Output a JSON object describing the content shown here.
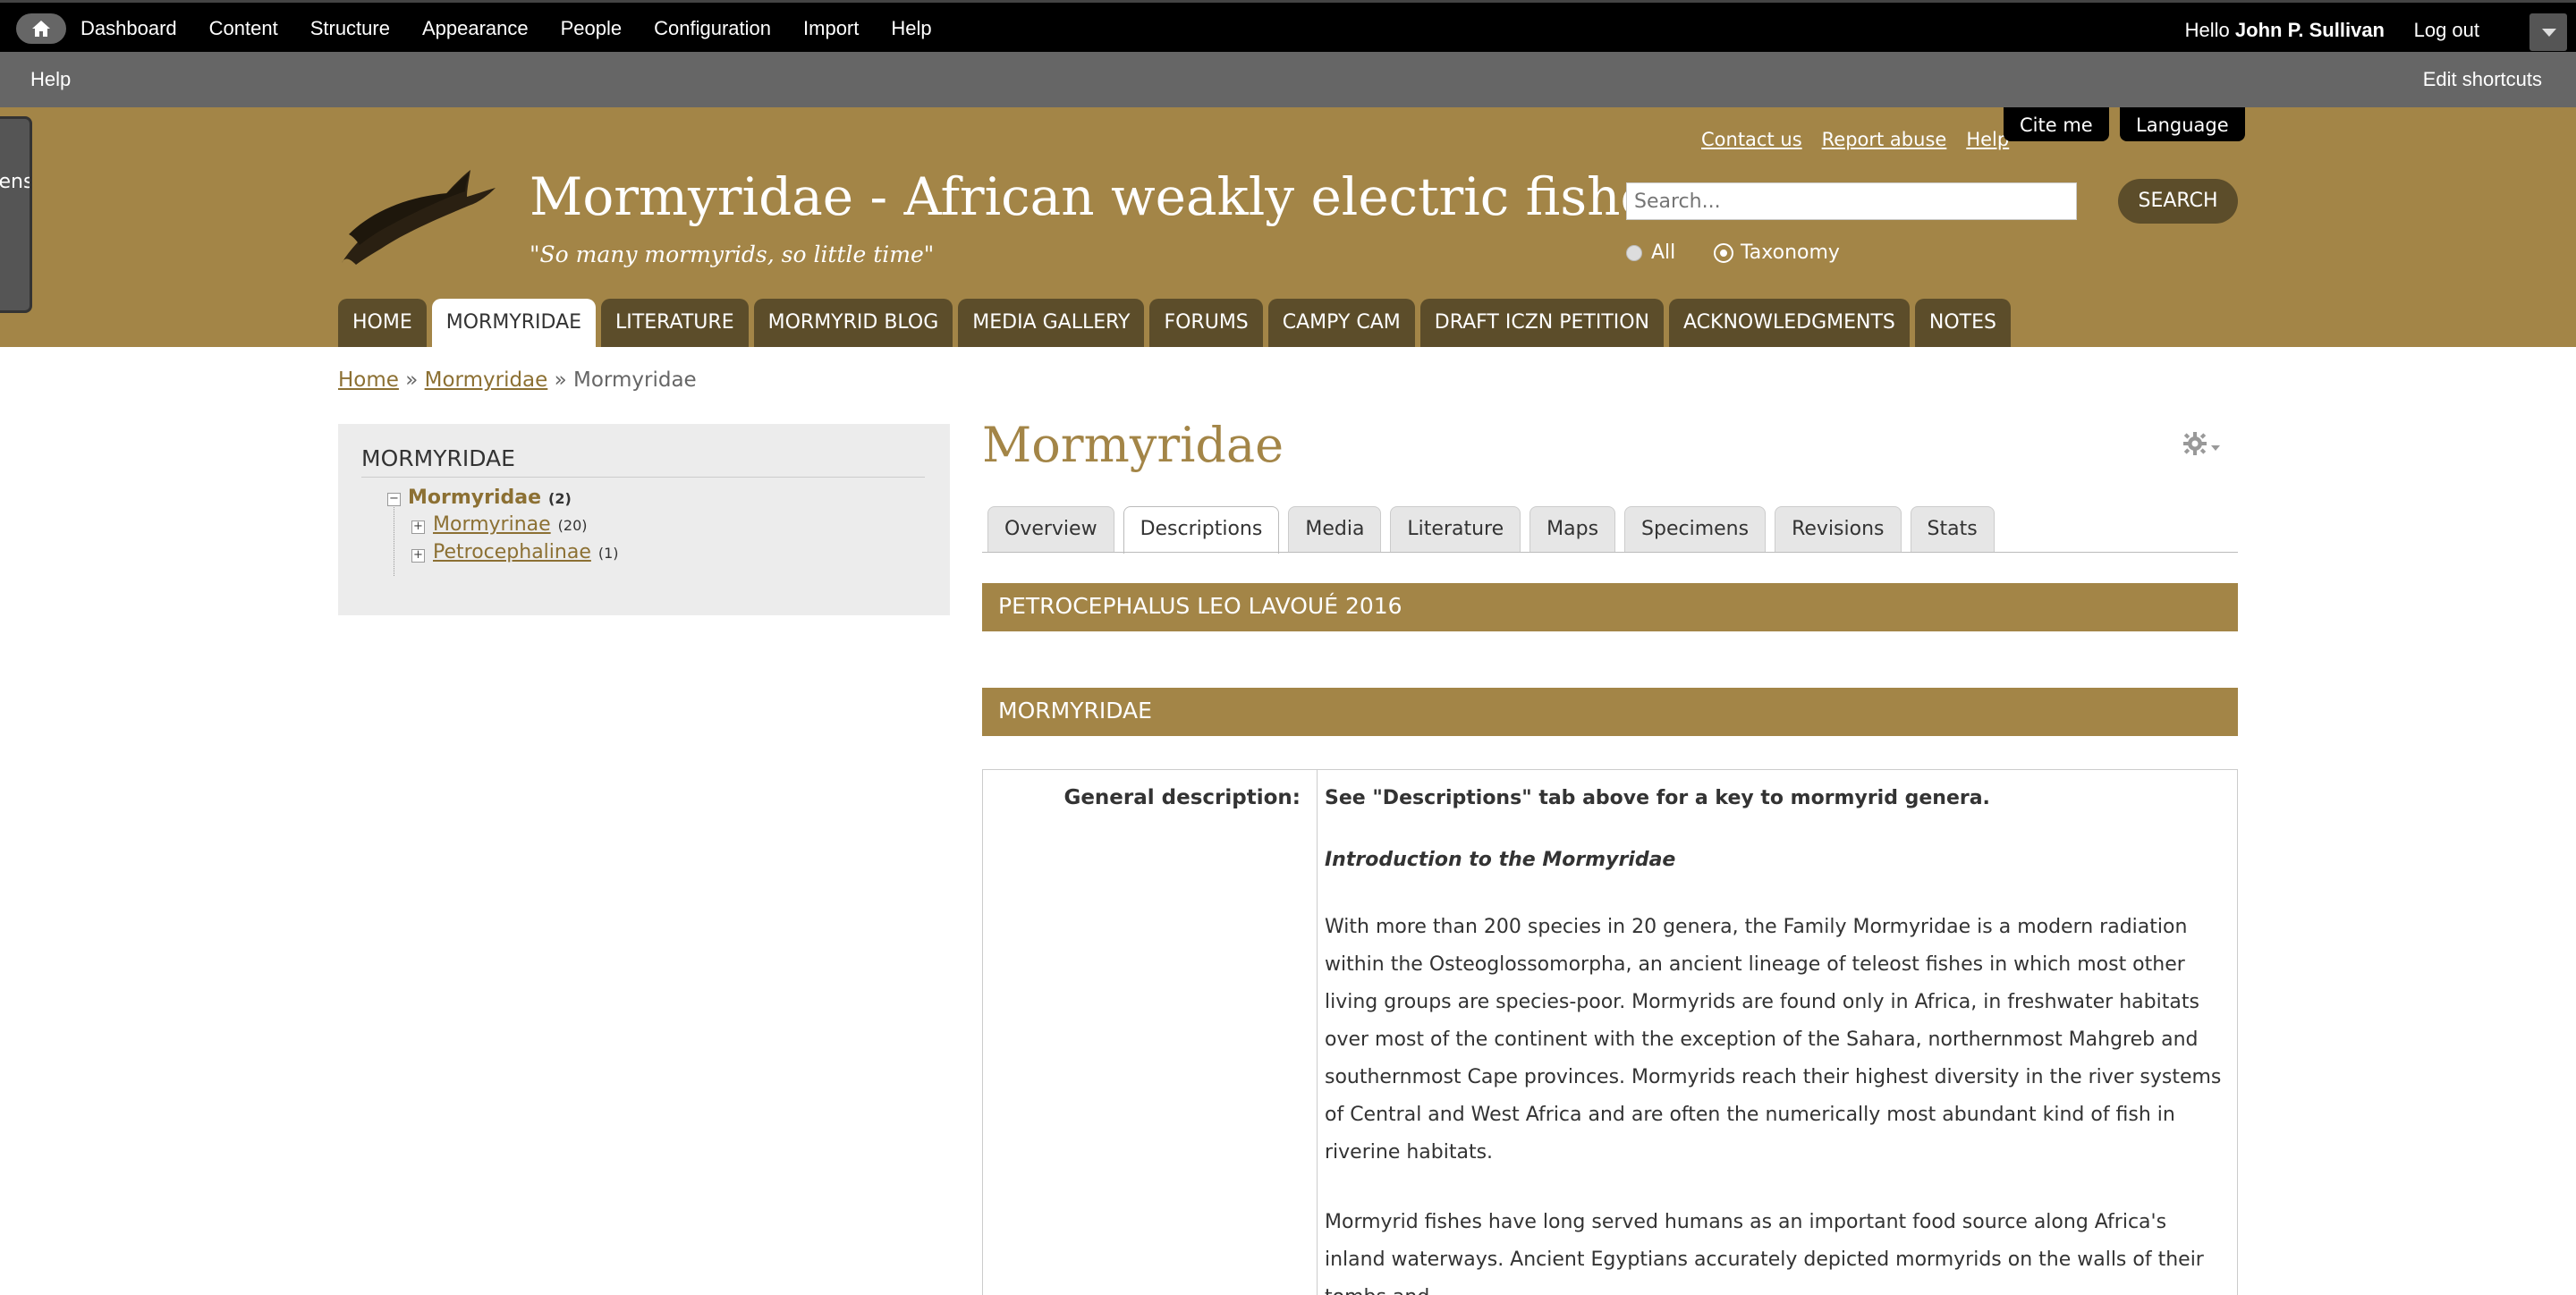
{
  "admin_bar": {
    "menu": [
      "Dashboard",
      "Content",
      "Structure",
      "Appearance",
      "People",
      "Configuration",
      "Import",
      "Help"
    ],
    "hello_prefix": "Hello",
    "user_name": "John P. Sullivan",
    "logout": "Log out"
  },
  "shortcut_bar": {
    "help": "Help",
    "edit_shortcuts": "Edit shortcuts"
  },
  "side_tab": {
    "label": "sens"
  },
  "header": {
    "site_name": "Mormyridae - African weakly electric fishes",
    "slogan": "\"So many mormyrids, so little time\"",
    "top_links": [
      "Contact us",
      "Report abuse",
      "Help"
    ],
    "cite_me": "Cite me",
    "language": "Language",
    "search_placeholder": "Search...",
    "search_button": "SEARCH",
    "radio_all": "All",
    "radio_taxonomy": "Taxonomy",
    "radio_selected": "Taxonomy"
  },
  "main_nav": [
    "HOME",
    "MORMYRIDAE",
    "LITERATURE",
    "MORMYRID BLOG",
    "MEDIA GALLERY",
    "FORUMS",
    "CAMPY CAM",
    "DRAFT ICZN PETITION",
    "ACKNOWLEDGMENTS",
    "NOTES"
  ],
  "main_nav_active": "MORMYRIDAE",
  "breadcrumb": {
    "home": "Home",
    "sep": "»",
    "mid": "Mormyridae",
    "current": "Mormyridae"
  },
  "sidebar": {
    "title": "MORMYRIDAE",
    "root": {
      "label": "Mormyridae",
      "count": "(2)"
    },
    "children": [
      {
        "label": "Mormyrinae",
        "count": "(20)"
      },
      {
        "label": "Petrocephalinae",
        "count": "(1)"
      }
    ]
  },
  "content": {
    "title": "Mormyridae",
    "tabs": [
      "Overview",
      "Descriptions",
      "Media",
      "Literature",
      "Maps",
      "Specimens",
      "Revisions",
      "Stats"
    ],
    "active_tab": "Descriptions",
    "section1": "PETROCEPHALUS LEO LAVOUÉ 2016",
    "section2": "MORMYRIDAE",
    "label": "General description:",
    "lead": "See \"Descriptions\" tab above for a key to mormyrid genera.",
    "intro_heading": "Introduction to the Mormyridae",
    "para1": "With more than 200 species in 20 genera, the Family Mormyridae is a modern radiation within the Osteoglossomorpha, an ancient lineage of teleost fishes in which most other living groups are species-poor. Mormyrids are found only in Africa, in freshwater habitats over most of the continent with the exception of the Sahara, northernmost Mahgreb and southernmost Cape provinces. Mormyrids reach their highest diversity in the river systems of Central and West Africa and are often the numerically most abundant kind of fish in riverine habitats.",
    "para2": "Mormyrid fishes have long served humans as an important food source along Africa's inland waterways. Ancient Egyptians accurately depicted mormyrids on the walls of their tombs and"
  },
  "colors": {
    "brand": "#a38547",
    "nav_dark": "#5c4d2a",
    "link": "#8c7033"
  }
}
